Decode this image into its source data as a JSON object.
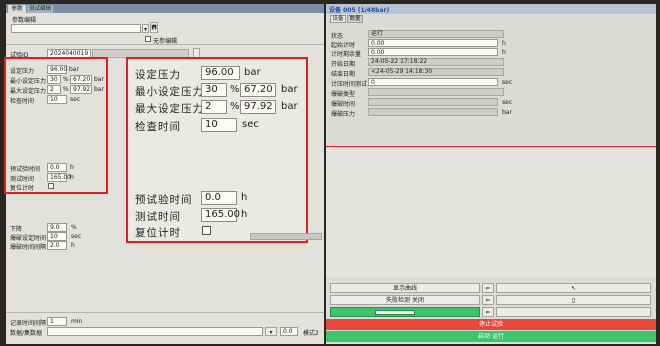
{
  "left": {
    "tabs": [
      "参数",
      "测试编辑"
    ],
    "file_label": "参数编辑",
    "checkbox_label": "无参编辑",
    "test_id_label": "试验ID",
    "test_id_value": "2024040019",
    "params": {
      "set_pressure": {
        "label": "设定压力",
        "value": "96.00",
        "unit": "bar"
      },
      "min_set": {
        "label": "最小设定压力",
        "pct": "30",
        "pct_unit": "%",
        "value": "67.20",
        "unit": "bar"
      },
      "max_set": {
        "label": "最大设定压力",
        "pct": "2",
        "pct_unit": "%",
        "value": "97.92",
        "unit": "bar"
      },
      "check_time": {
        "label": "检查时间",
        "value": "10",
        "unit": "sec"
      },
      "pretest_time": {
        "label": "预试验时间",
        "value": "0.0",
        "unit": "h"
      },
      "test_time": {
        "label": "测试时间",
        "value": "165.00",
        "unit": "h"
      },
      "reset_timer": {
        "label": "复位计时"
      }
    },
    "lower": {
      "drop": {
        "label": "下降",
        "value": "9.0",
        "unit": "%"
      },
      "burst_set": {
        "label": "爆破设定时间",
        "value": "10",
        "unit": "sec"
      },
      "burst_interval": {
        "label": "爆破时间间隔",
        "value": "2.0",
        "unit": "h"
      }
    },
    "bottom": {
      "record_interval": {
        "label": "记录时间间隔",
        "value": "1",
        "unit": "min"
      },
      "file_label": "数据/集数据",
      "file_value": "0.0",
      "mode_label": "模式2"
    }
  },
  "right": {
    "title": "设备 005 (1/48bar)",
    "tabs": [
      "设备",
      "数据"
    ],
    "rows": [
      {
        "label": "状态",
        "value": "运行",
        "unit": ""
      },
      {
        "label": "起始计时",
        "value": "0.00",
        "unit": "h"
      },
      {
        "label": "计时剩余量",
        "value": "0.00",
        "unit": "h"
      },
      {
        "label": "开始日期",
        "value": "24-05-22 17:18:22",
        "unit": ""
      },
      {
        "label": "结束日期",
        "value": "<24-05-29 14:18:30",
        "unit": ""
      },
      {
        "label": "计压时间测试",
        "value": "0",
        "unit": "sec"
      },
      {
        "label": "爆破类型",
        "value": "",
        "unit": ""
      },
      {
        "label": "爆破时间",
        "value": "",
        "unit": "sec"
      },
      {
        "label": "爆破压力",
        "value": "",
        "unit": "bar"
      }
    ],
    "buttons": {
      "show_graph": "显示曲线",
      "fail_test": "失败检测 关闭",
      "stop": "停止试验",
      "start": "启动 运行"
    }
  },
  "colors": {
    "highlight_red": "#e0201a",
    "stop_red": "#e8473e",
    "start_green": "#3cc56a"
  }
}
